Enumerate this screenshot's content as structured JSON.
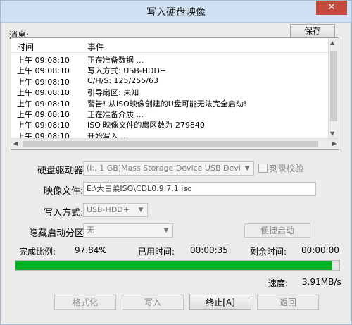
{
  "window": {
    "title": "写入硬盘映像",
    "close_glyph": "✕"
  },
  "messages": {
    "label": "消息:",
    "save_label": "保存",
    "columns": {
      "time": "时间",
      "event": "事件"
    },
    "rows": [
      {
        "time": "上午 09:08:10",
        "event": "正在准备数据 ..."
      },
      {
        "time": "上午 09:08:10",
        "event": "写入方式: USB-HDD+"
      },
      {
        "time": "上午 09:08:10",
        "event": "C/H/S: 125/255/63"
      },
      {
        "time": "上午 09:08:10",
        "event": "引导扇区: 未知"
      },
      {
        "time": "上午 09:08:10",
        "event": "警告! 从ISO映像创建的U盘可能无法完全启动!"
      },
      {
        "time": "上午 09:08:10",
        "event": "正在准备介质 ..."
      },
      {
        "time": "上午 09:08:10",
        "event": "ISO 映像文件的扇区数为 279840"
      },
      {
        "time": "上午 09:08:10",
        "event": "开始写入 ..."
      }
    ]
  },
  "form": {
    "drive_label": "硬盘驱动器:",
    "drive_value": "(I:, 1 GB)Mass Storage Device USB Devi",
    "verify_label": "刻录校验",
    "image_label": "映像文件:",
    "image_value": "E:\\大白菜ISO\\CDL0.9.7.1.iso",
    "method_label": "写入方式:",
    "method_value": "USB-HDD+",
    "hidden_label": "隐藏启动分区:",
    "hidden_value": "无",
    "boot_button": "便捷启动"
  },
  "status": {
    "ratio_label": "完成比例:",
    "ratio_value": "97.84%",
    "elapsed_label": "已用时间:",
    "elapsed_value": "00:00:35",
    "remaining_label": "剩余时间:",
    "remaining_value": "00:00:00",
    "progress_percent": 97.84,
    "progress_color": "#06b025",
    "speed_label": "速度:",
    "speed_value": "3.91MB/s"
  },
  "buttons": {
    "format": "格式化",
    "write": "写入",
    "stop": "终止[A]",
    "return": "返回"
  }
}
